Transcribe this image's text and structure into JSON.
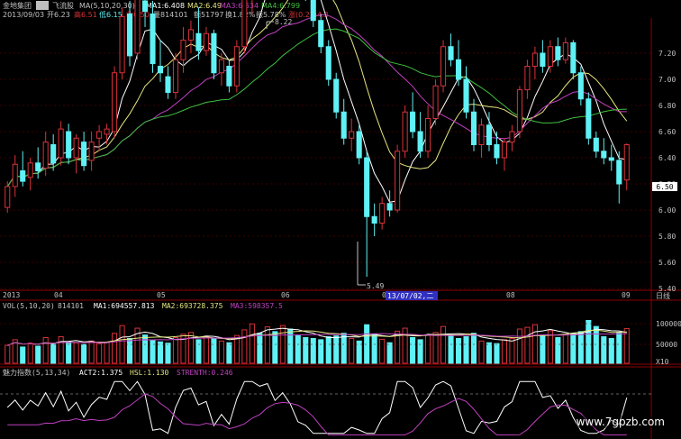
{
  "header": {
    "stock_name": "金地集团",
    "period_btn": "日",
    "indicator_name": "飞流股",
    "ma_params": "MA(5,10,20,30)",
    "ma1": "MA1:6.408",
    "ma2": "MA2:6.49",
    "ma3": "MA3:6.634",
    "ma4": "MA4:6.799",
    "date": "2013/09/03",
    "open": "开6.23",
    "high": "高6.51",
    "low": "低6.15",
    "close": "收6.50",
    "volume": "量814101",
    "amount": "额51797",
    "turnover": "换1.82%",
    "amplitude": "振5.78%",
    "change": "涨(0.27)4.3"
  },
  "price_axis": {
    "ticks": [
      "7.20",
      "7.00",
      "6.80",
      "6.60",
      "6.40",
      "6.20",
      "6.00",
      "5.80",
      "5.60",
      "5.40"
    ],
    "current": "6.50"
  },
  "annotations": {
    "high": "8.22",
    "low": "5.49"
  },
  "date_axis": {
    "labels": [
      "2013",
      "04",
      "05",
      "06",
      "07",
      "08",
      "09"
    ],
    "cursor_date": "13/07/02,二",
    "period": "日线"
  },
  "vol_panel": {
    "title": "VOL(5,10,20)",
    "value": "814101",
    "ma1": "MA1:694557.813",
    "ma2": "MA2:693728.375",
    "ma3": "MA3:598357.5",
    "ticks": [
      "100000",
      "50000"
    ],
    "unit": "X10"
  },
  "ind_panel": {
    "title": "魅力指数(5,13,34)",
    "act2": "ACT2:1.375",
    "hsl": "HSL:1.130",
    "strength": "STRENTH:0.246"
  },
  "watermark": "www.7gpzb.com",
  "colors": {
    "bg": "#000000",
    "up": "#d9323a",
    "down": "#5ff1f5",
    "ma1": "#ffffff",
    "ma2": "#e6e680",
    "ma3": "#c040c0",
    "ma4": "#40c040",
    "grid": "#7a0000",
    "axis_text": "#c0c0c0"
  },
  "chart_data": {
    "type": "candlestick",
    "ylim": [
      5.4,
      7.4
    ],
    "candles": [
      {
        "o": 6.02,
        "h": 6.22,
        "l": 5.98,
        "c": 6.18
      },
      {
        "o": 6.18,
        "h": 6.42,
        "l": 6.1,
        "c": 6.35
      },
      {
        "o": 6.3,
        "h": 6.45,
        "l": 6.18,
        "c": 6.22
      },
      {
        "o": 6.25,
        "h": 6.4,
        "l": 6.15,
        "c": 6.36
      },
      {
        "o": 6.36,
        "h": 6.48,
        "l": 6.24,
        "c": 6.3
      },
      {
        "o": 6.32,
        "h": 6.6,
        "l": 6.26,
        "c": 6.52
      },
      {
        "o": 6.5,
        "h": 6.58,
        "l": 6.3,
        "c": 6.36
      },
      {
        "o": 6.4,
        "h": 6.68,
        "l": 6.34,
        "c": 6.62
      },
      {
        "o": 6.6,
        "h": 6.66,
        "l": 6.35,
        "c": 6.4
      },
      {
        "o": 6.4,
        "h": 6.58,
        "l": 6.28,
        "c": 6.55
      },
      {
        "o": 6.52,
        "h": 6.6,
        "l": 6.3,
        "c": 6.34
      },
      {
        "o": 6.38,
        "h": 6.6,
        "l": 6.3,
        "c": 6.52
      },
      {
        "o": 6.55,
        "h": 6.65,
        "l": 6.45,
        "c": 6.6
      },
      {
        "o": 6.58,
        "h": 6.66,
        "l": 6.5,
        "c": 6.62
      },
      {
        "o": 6.6,
        "h": 7.1,
        "l": 6.55,
        "c": 7.05
      },
      {
        "o": 7.05,
        "h": 7.55,
        "l": 7.0,
        "c": 7.48
      },
      {
        "o": 7.5,
        "h": 7.6,
        "l": 7.1,
        "c": 7.18
      },
      {
        "o": 7.2,
        "h": 7.7,
        "l": 7.15,
        "c": 7.62
      },
      {
        "o": 7.6,
        "h": 7.7,
        "l": 7.4,
        "c": 7.52
      },
      {
        "o": 7.5,
        "h": 7.6,
        "l": 7.05,
        "c": 7.12
      },
      {
        "o": 7.1,
        "h": 7.3,
        "l": 6.98,
        "c": 7.05
      },
      {
        "o": 7.02,
        "h": 7.1,
        "l": 6.85,
        "c": 6.9
      },
      {
        "o": 6.9,
        "h": 7.2,
        "l": 6.85,
        "c": 7.15
      },
      {
        "o": 7.15,
        "h": 7.4,
        "l": 7.05,
        "c": 7.3
      },
      {
        "o": 7.3,
        "h": 7.45,
        "l": 7.2,
        "c": 7.38
      },
      {
        "o": 7.35,
        "h": 7.55,
        "l": 7.15,
        "c": 7.22
      },
      {
        "o": 7.22,
        "h": 7.4,
        "l": 7.18,
        "c": 7.35
      },
      {
        "o": 7.35,
        "h": 7.38,
        "l": 7.0,
        "c": 7.05
      },
      {
        "o": 7.05,
        "h": 7.2,
        "l": 6.95,
        "c": 7.15
      },
      {
        "o": 7.1,
        "h": 7.15,
        "l": 6.9,
        "c": 6.95
      },
      {
        "o": 6.95,
        "h": 7.3,
        "l": 6.9,
        "c": 7.25
      },
      {
        "o": 7.25,
        "h": 7.7,
        "l": 7.2,
        "c": 7.65
      },
      {
        "o": 7.65,
        "h": 7.95,
        "l": 7.5,
        "c": 7.8
      },
      {
        "o": 7.8,
        "h": 7.95,
        "l": 7.65,
        "c": 7.72
      },
      {
        "o": 7.72,
        "h": 8.0,
        "l": 7.7,
        "c": 7.95
      },
      {
        "o": 7.95,
        "h": 8.05,
        "l": 7.8,
        "c": 7.88
      },
      {
        "o": 7.88,
        "h": 8.15,
        "l": 7.85,
        "c": 8.05
      },
      {
        "o": 8.05,
        "h": 8.22,
        "l": 7.9,
        "c": 7.95
      },
      {
        "o": 7.95,
        "h": 8.05,
        "l": 7.7,
        "c": 7.75
      },
      {
        "o": 7.75,
        "h": 7.9,
        "l": 7.6,
        "c": 7.65
      },
      {
        "o": 7.65,
        "h": 7.7,
        "l": 7.4,
        "c": 7.45
      },
      {
        "o": 7.45,
        "h": 7.5,
        "l": 7.2,
        "c": 7.25
      },
      {
        "o": 7.25,
        "h": 7.3,
        "l": 6.95,
        "c": 7.0
      },
      {
        "o": 7.0,
        "h": 7.05,
        "l": 6.7,
        "c": 6.75
      },
      {
        "o": 6.75,
        "h": 6.85,
        "l": 6.5,
        "c": 6.55
      },
      {
        "o": 6.55,
        "h": 6.7,
        "l": 6.45,
        "c": 6.6
      },
      {
        "o": 6.6,
        "h": 6.65,
        "l": 6.35,
        "c": 6.4
      },
      {
        "o": 6.4,
        "h": 6.45,
        "l": 5.49,
        "c": 5.95
      },
      {
        "o": 5.95,
        "h": 6.05,
        "l": 5.8,
        "c": 5.9
      },
      {
        "o": 5.9,
        "h": 6.1,
        "l": 5.85,
        "c": 6.05
      },
      {
        "o": 6.05,
        "h": 6.15,
        "l": 5.95,
        "c": 6.0
      },
      {
        "o": 6.0,
        "h": 6.5,
        "l": 5.98,
        "c": 6.45
      },
      {
        "o": 6.45,
        "h": 6.8,
        "l": 6.4,
        "c": 6.75
      },
      {
        "o": 6.75,
        "h": 6.9,
        "l": 6.55,
        "c": 6.6
      },
      {
        "o": 6.6,
        "h": 6.75,
        "l": 6.4,
        "c": 6.45
      },
      {
        "o": 6.45,
        "h": 6.8,
        "l": 6.4,
        "c": 6.7
      },
      {
        "o": 6.7,
        "h": 7.0,
        "l": 6.65,
        "c": 6.95
      },
      {
        "o": 6.95,
        "h": 7.3,
        "l": 6.9,
        "c": 7.25
      },
      {
        "o": 7.25,
        "h": 7.35,
        "l": 7.1,
        "c": 7.15
      },
      {
        "o": 7.15,
        "h": 7.3,
        "l": 6.95,
        "c": 7.0
      },
      {
        "o": 7.0,
        "h": 7.1,
        "l": 6.7,
        "c": 6.75
      },
      {
        "o": 6.75,
        "h": 6.85,
        "l": 6.45,
        "c": 6.5
      },
      {
        "o": 6.5,
        "h": 6.7,
        "l": 6.4,
        "c": 6.65
      },
      {
        "o": 6.65,
        "h": 6.75,
        "l": 6.45,
        "c": 6.5
      },
      {
        "o": 6.5,
        "h": 6.6,
        "l": 6.35,
        "c": 6.4
      },
      {
        "o": 6.4,
        "h": 6.55,
        "l": 6.3,
        "c": 6.52
      },
      {
        "o": 6.52,
        "h": 6.65,
        "l": 6.45,
        "c": 6.6
      },
      {
        "o": 6.6,
        "h": 6.95,
        "l": 6.55,
        "c": 6.92
      },
      {
        "o": 6.92,
        "h": 7.15,
        "l": 6.85,
        "c": 7.1
      },
      {
        "o": 7.1,
        "h": 7.25,
        "l": 7.0,
        "c": 7.2
      },
      {
        "o": 7.2,
        "h": 7.3,
        "l": 7.05,
        "c": 7.1
      },
      {
        "o": 7.1,
        "h": 7.3,
        "l": 7.05,
        "c": 7.25
      },
      {
        "o": 7.25,
        "h": 7.32,
        "l": 7.1,
        "c": 7.15
      },
      {
        "o": 7.15,
        "h": 7.32,
        "l": 7.12,
        "c": 7.28
      },
      {
        "o": 7.28,
        "h": 7.3,
        "l": 7.0,
        "c": 7.05
      },
      {
        "o": 7.05,
        "h": 7.1,
        "l": 6.8,
        "c": 6.85
      },
      {
        "o": 6.85,
        "h": 6.9,
        "l": 6.5,
        "c": 6.55
      },
      {
        "o": 6.55,
        "h": 6.6,
        "l": 6.4,
        "c": 6.45
      },
      {
        "o": 6.45,
        "h": 6.55,
        "l": 6.35,
        "c": 6.4
      },
      {
        "o": 6.4,
        "h": 6.5,
        "l": 6.3,
        "c": 6.38
      },
      {
        "o": 6.38,
        "h": 6.45,
        "l": 6.05,
        "c": 6.2
      },
      {
        "o": 6.23,
        "h": 6.51,
        "l": 6.15,
        "c": 6.5
      }
    ],
    "volume": [
      42,
      55,
      38,
      47,
      40,
      60,
      45,
      62,
      50,
      48,
      44,
      52,
      46,
      49,
      70,
      88,
      58,
      82,
      66,
      54,
      50,
      47,
      60,
      68,
      72,
      55,
      63,
      57,
      52,
      48,
      65,
      78,
      92,
      70,
      85,
      74,
      88,
      80,
      66,
      60,
      58,
      55,
      62,
      64,
      70,
      58,
      52,
      90,
      68,
      56,
      48,
      75,
      82,
      60,
      55,
      66,
      72,
      86,
      64,
      58,
      62,
      70,
      52,
      48,
      46,
      55,
      58,
      80,
      84,
      90,
      66,
      76,
      60,
      68,
      70,
      74,
      100,
      86,
      62,
      58,
      72,
      81
    ],
    "volume_ylim": [
      0,
      120
    ],
    "indicator_ylim": [
      0,
      4
    ]
  }
}
